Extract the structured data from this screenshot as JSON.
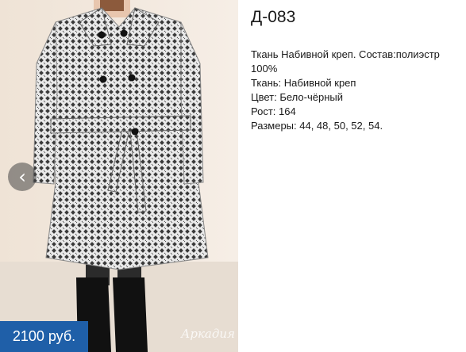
{
  "product": {
    "sku": "Д-083",
    "price": "2100 руб.",
    "watermark": "Аркадия",
    "description_lines": [
      "Ткань Набивной креп. Состав:полиэстр 100%",
      "Ткань: Набивной креп",
      "Цвет: Бело-чёрный",
      "Рост: 164",
      "Размеры: 44, 48, 50, 52, 54."
    ]
  },
  "gallery": {
    "prev_arrow_glyph": "‹",
    "prev_icon": "chevron-left-icon"
  },
  "colors": {
    "price_background": "#1f5fa8",
    "coat_pattern": "#2a2a2a",
    "background": "#f0e7dc"
  }
}
